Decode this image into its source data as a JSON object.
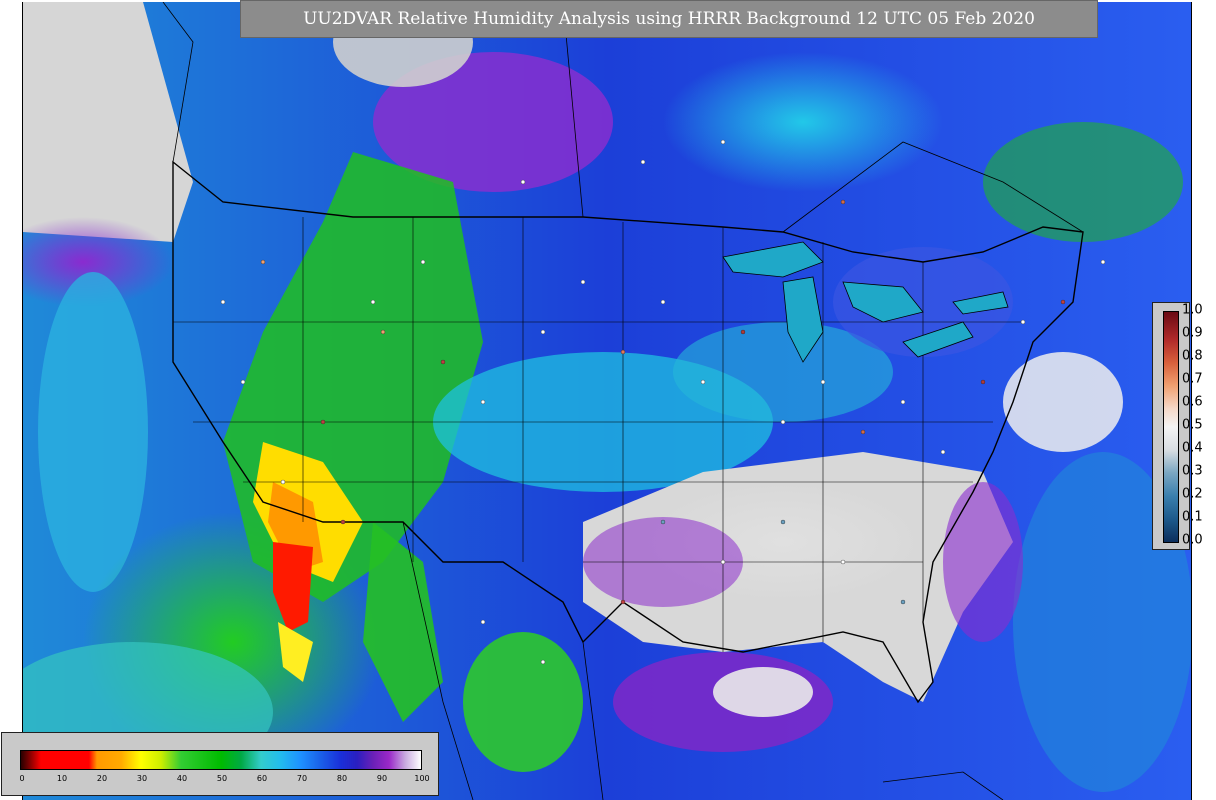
{
  "title": "UU2DVAR Relative Humidity Analysis using HRRR Background 12 UTC 05 Feb 2020",
  "map": {
    "region": "Contiguous United States with adjacent ocean, Canada and Mexico",
    "colors": {
      "ocean_humid": "#2244dd",
      "ocean_moist": "#1fb8e6",
      "dry_west": "#22cc22",
      "very_dry": "#ff2200",
      "dry_orange": "#ffaa00",
      "saturated": "#d8d8d8",
      "high_rh_purple": "#7a1fb0"
    }
  },
  "rh_colorbar": {
    "ticks": [
      "0",
      "10",
      "20",
      "30",
      "40",
      "50",
      "60",
      "70",
      "80",
      "90",
      "100"
    ]
  },
  "obs_colorbar": {
    "ticks": [
      "0.0",
      "0.1",
      "0.2",
      "0.3",
      "0.4",
      "0.5",
      "0.6",
      "0.7",
      "0.8",
      "0.9",
      "1.0"
    ]
  }
}
